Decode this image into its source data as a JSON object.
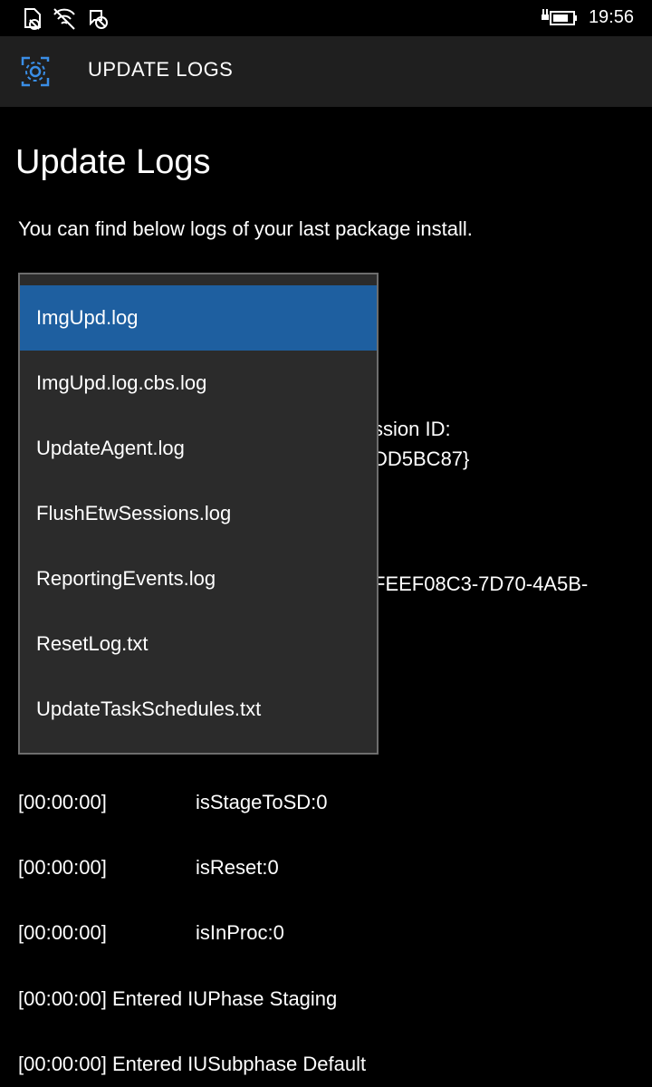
{
  "status_bar": {
    "time": "19:56",
    "icons": [
      "sim-icon",
      "wifi-icon",
      "notification-off-icon",
      "battery-icon"
    ]
  },
  "header": {
    "icon": "update-gear-icon",
    "title": "UPDATE LOGS"
  },
  "page": {
    "title": "Update Logs",
    "description": "You can find below logs of your last package install."
  },
  "dropdown": {
    "selected_index": 0,
    "items": [
      {
        "label": "ImgUpd.log"
      },
      {
        "label": "ImgUpd.log.cbs.log"
      },
      {
        "label": "UpdateAgent.log"
      },
      {
        "label": "FlushEtwSessions.log"
      },
      {
        "label": "ReportingEvents.log"
      },
      {
        "label": "ResetLog.txt"
      },
      {
        "label": "UpdateTaskSchedules.txt"
      }
    ]
  },
  "occluded_text": {
    "session_id_label": "ssion ID:",
    "session_id_value": "DD5BC87}",
    "guid_fragment": "FEEF08C3-7D70-4A5B-"
  },
  "log_lines": [
    {
      "timestamp": "[00:00:00]",
      "message": "isStageToSD:0"
    },
    {
      "timestamp": "[00:00:00]",
      "message": "isReset:0"
    },
    {
      "timestamp": "[00:00:00]",
      "message": "isInProc:0"
    },
    {
      "timestamp": "[00:00:00]",
      "message": "Entered IUPhase Staging"
    },
    {
      "timestamp": "[00:00:00]",
      "message": "Entered IUSubphase Default"
    }
  ],
  "colors": {
    "background": "#000000",
    "header_bg": "#1f1f1f",
    "accent": "#1e5fa0",
    "dropdown_bg": "#2b2b2b",
    "header_icon": "#3a8ee6"
  }
}
